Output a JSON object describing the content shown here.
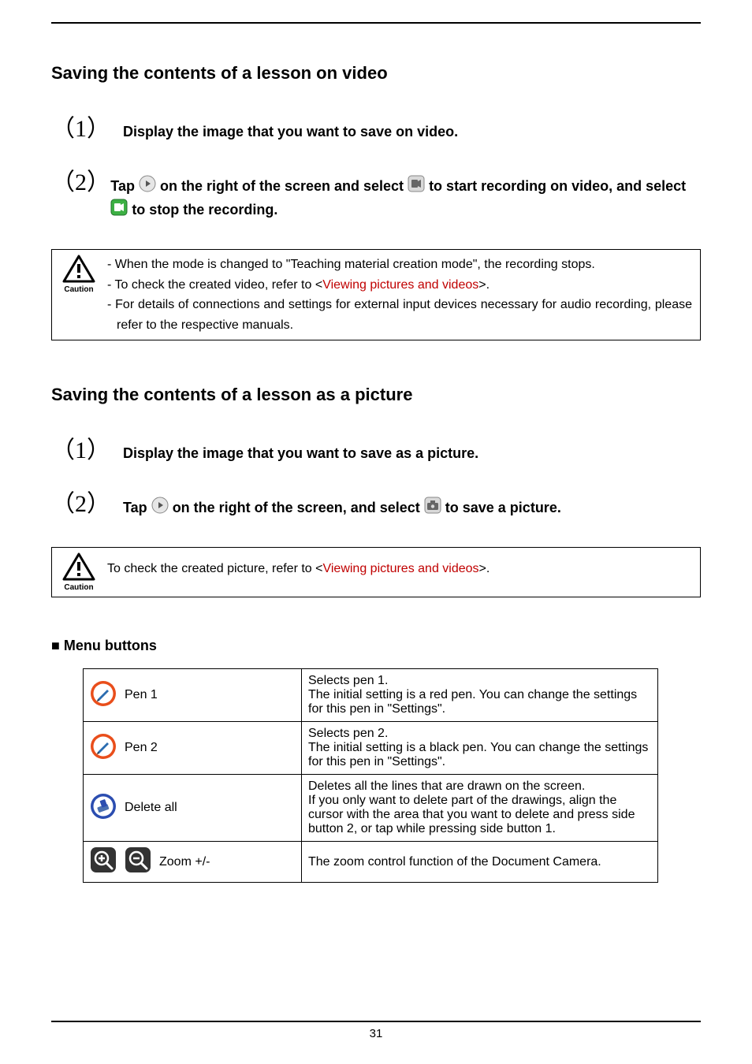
{
  "section1": {
    "heading": "Saving the contents of a lesson on video",
    "step1_num": "（1）",
    "step1_text": "Display the image that you want to save on video.",
    "step2_num": "（2）",
    "step2_pre": "Tap ",
    "step2_mid1": " on the right of the screen and select ",
    "step2_mid2": " to start recording on video, and select ",
    "step2_end": " to stop the recording.",
    "caution1": "- When the mode is changed to \"Teaching material creation mode\", the recording stops.",
    "caution2_pre": "- To check the created video, refer to <",
    "caution2_link": "Viewing pictures and videos",
    "caution2_post": ">.",
    "caution3": "- For details of connections and settings for external input devices necessary for audio recording, please refer to the respective manuals."
  },
  "section2": {
    "heading": "Saving the contents of a lesson as a picture",
    "step1_num": "（1）",
    "step1_text": "Display the image that you want to save as a picture.",
    "step2_num": "（2）",
    "step2_pre": "Tap ",
    "step2_mid": " on the right of the screen, and select ",
    "step2_end": " to save a picture.",
    "caution_pre": "To check the created picture, refer to <",
    "caution_link": "Viewing pictures and videos",
    "caution_post": ">."
  },
  "caution_label": "Caution",
  "menu": {
    "heading": "■ Menu buttons",
    "rows": [
      {
        "label": "Pen 1",
        "desc": "Selects pen 1.\nThe initial setting is a red pen. You can change the settings for this pen in \"Settings\"."
      },
      {
        "label": "Pen 2",
        "desc": "Selects pen 2.\nThe initial setting is a black pen. You can change the settings for this pen in \"Settings\"."
      },
      {
        "label": "Delete all",
        "desc": "Deletes all the lines that are drawn on the screen.\nIf you only want to delete part of the drawings, align the cursor with the area that you want to delete and press side button 2, or tap while pressing side button 1."
      },
      {
        "label": "Zoom +/-",
        "desc": "The zoom control function of the Document Camera."
      }
    ]
  },
  "page_number": "31"
}
